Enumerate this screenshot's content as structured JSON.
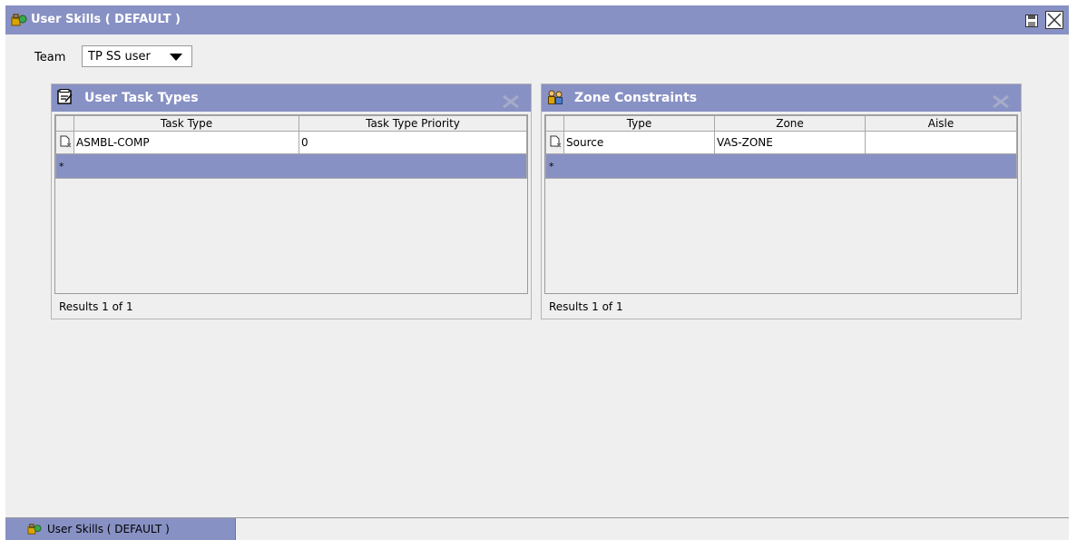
{
  "window": {
    "title": "User Skills ( DEFAULT )",
    "title_icon": "user-skills-icon",
    "accent_color": "#8891c4",
    "save_icon": "save-icon",
    "close_icon": "close-icon"
  },
  "team": {
    "label": "Team",
    "selected": "TP SS user"
  },
  "task_types": {
    "title": "User Task Types",
    "icon": "task-list-icon",
    "columns": [
      "Task Type",
      "Task Type Priority"
    ],
    "rows": [
      {
        "task_type": "ASMBL-COMP",
        "priority": "0"
      }
    ],
    "new_row_marker": "*",
    "results": "Results 1 of 1"
  },
  "zone_constraints": {
    "title": "Zone Constraints",
    "icon": "users-icon",
    "columns": [
      "Type",
      "Zone",
      "Aisle"
    ],
    "rows": [
      {
        "type": "Source",
        "zone": "VAS-ZONE",
        "aisle": ""
      }
    ],
    "new_row_marker": "*",
    "results": "Results 1 of 1"
  },
  "taskbar": {
    "tab_label": "User Skills ( DEFAULT )"
  }
}
